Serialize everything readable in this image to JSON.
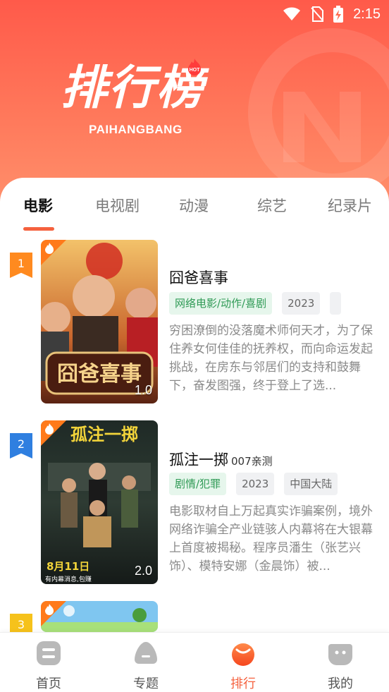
{
  "status_bar": {
    "time": "2:15"
  },
  "header": {
    "title": "排行榜",
    "subtitle": "PAIHANGBANG",
    "hot_badge": "HOT"
  },
  "tabs": [
    {
      "label": "电影",
      "active": true
    },
    {
      "label": "电视剧",
      "active": false
    },
    {
      "label": "动漫",
      "active": false
    },
    {
      "label": "综艺",
      "active": false
    },
    {
      "label": "纪录片",
      "active": false
    }
  ],
  "items": [
    {
      "rank": "1",
      "rank_color": "#ff8a1f",
      "title": "囧爸喜事",
      "subtitle": "",
      "genre": "网络电影/动作/喜剧",
      "year": "2023",
      "region": "",
      "description": "穷困潦倒的没落魔术师何天才，为了保住养女何佳佳的抚养权，而向命运发起挑战，在房东与邻居们的支持和鼓舞下，奋发图强，终于登上了选...",
      "score": "1.0",
      "poster_text": "囧爸喜事"
    },
    {
      "rank": "2",
      "rank_color": "#2f7fe0",
      "title": "孤注一掷",
      "subtitle": "007亲测",
      "genre": "剧情/犯罪",
      "year": "2023",
      "region": "中国大陆",
      "description": "电影取材自上万起真实诈骗案例，境外网络诈骗全产业链骇人内幕将在大银幕上首度被揭秘。程序员潘生（张艺兴饰）、模特安娜（金晨饰）被...",
      "score": "2.0",
      "poster_text": "孤注一掷",
      "poster_date": "8月11日",
      "poster_note": "有内幕消息,包赚"
    },
    {
      "rank": "3",
      "rank_color": "#f6c21b"
    }
  ],
  "bottom_nav": [
    {
      "label": "首页",
      "icon": "home-icon",
      "active": false
    },
    {
      "label": "专题",
      "icon": "topic-icon",
      "active": false
    },
    {
      "label": "排行",
      "icon": "ranking-icon",
      "active": true
    },
    {
      "label": "我的",
      "icon": "profile-icon",
      "active": false
    }
  ],
  "colors": {
    "accent": "#f5613e",
    "header_top": "#ff5a4a",
    "genre_green": "#2f9a55"
  }
}
